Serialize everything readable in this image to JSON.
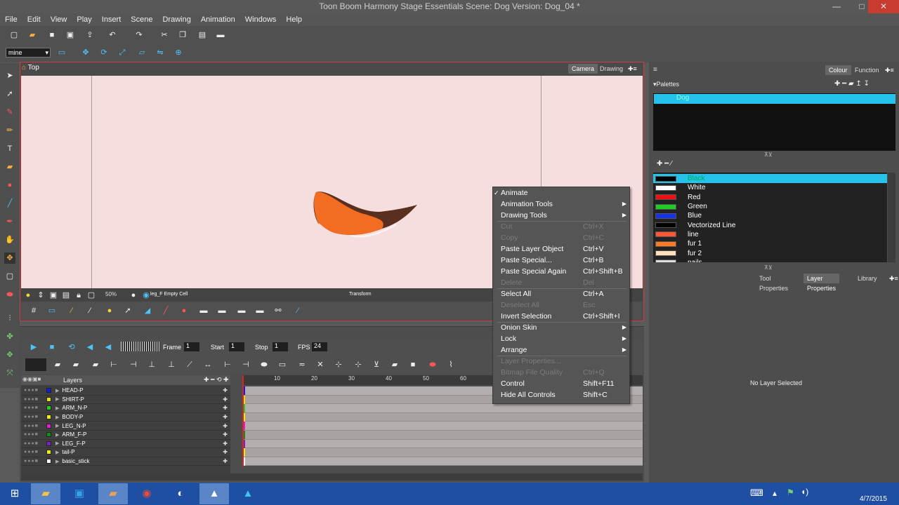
{
  "window": {
    "title": "Toon Boom Harmony Stage Essentials Scene: Dog Version: Dog_04 *",
    "min": "—",
    "max": "□",
    "close": "✕"
  },
  "menus": [
    "File",
    "Edit",
    "View",
    "Play",
    "Insert",
    "Scene",
    "Drawing",
    "Animation",
    "Windows",
    "Help"
  ],
  "toolbar": {
    "preset_value": "mine"
  },
  "view": {
    "tab": "Top",
    "camera_tab": "Camera",
    "drawing_tab": "Drawing",
    "zoom": "50%",
    "layer_name": "leg_F Empty Cell",
    "mode": "Transform"
  },
  "timeline": {
    "frame_label": "Frame",
    "frame_value": "1",
    "start_label": "Start",
    "start_value": "1",
    "stop_label": "Stop",
    "stop_value": "1",
    "fps_label": "FPS",
    "fps_value": "24",
    "layers_header": "Layers",
    "ruler": [
      "10",
      "20",
      "30",
      "40",
      "50",
      "60"
    ]
  },
  "layers": [
    {
      "name": "HEAD-P",
      "color": "#1020e0"
    },
    {
      "name": "SHIRT-P",
      "color": "#e8e000"
    },
    {
      "name": "ARM_N-P",
      "color": "#20d020"
    },
    {
      "name": "BODY-P",
      "color": "#f0f000"
    },
    {
      "name": "LEG_N-P",
      "color": "#e020d0"
    },
    {
      "name": "ARM_F-P",
      "color": "#109010"
    },
    {
      "name": "LEG_F-P",
      "color": "#8020c0"
    },
    {
      "name": "tail-P",
      "color": "#f0f000"
    },
    {
      "name": "basic_stick",
      "color": "#ffffff"
    }
  ],
  "context_menu": [
    {
      "label": "Animate",
      "check": "✓"
    },
    {
      "label": "Animation Tools",
      "submenu": true
    },
    {
      "label": "Drawing Tools",
      "submenu": true
    },
    {
      "sep": true
    },
    {
      "label": "Cut",
      "shortcut": "Ctrl+X",
      "disabled": true
    },
    {
      "label": "Copy",
      "shortcut": "Ctrl+C",
      "disabled": true
    },
    {
      "label": "Paste Layer Object",
      "shortcut": "Ctrl+V"
    },
    {
      "label": "Paste Special...",
      "shortcut": "Ctrl+B"
    },
    {
      "label": "Paste Special Again",
      "shortcut": "Ctrl+Shift+B"
    },
    {
      "label": "Delete",
      "shortcut": "Del",
      "disabled": true
    },
    {
      "sep": true
    },
    {
      "label": "Select All",
      "shortcut": "Ctrl+A"
    },
    {
      "label": "Deselect All",
      "shortcut": "Esc",
      "disabled": true
    },
    {
      "label": "Invert Selection",
      "shortcut": "Ctrl+Shift+I"
    },
    {
      "sep": true
    },
    {
      "label": "Onion Skin",
      "submenu": true
    },
    {
      "label": "Lock",
      "submenu": true
    },
    {
      "label": "Arrange",
      "submenu": true
    },
    {
      "sep": true
    },
    {
      "label": "Layer Properties...",
      "disabled": true
    },
    {
      "label": "Bitmap File Quality",
      "shortcut": "Ctrl+Q",
      "disabled": true
    },
    {
      "label": "Control",
      "shortcut": "Shift+F11"
    },
    {
      "label": "Hide All Controls",
      "shortcut": "Shift+C"
    }
  ],
  "right": {
    "tab_colour": "Colour",
    "tab_function": "Function",
    "palettes_label": "Palettes",
    "palette_name": "Dog",
    "colours": [
      {
        "name": "Black",
        "hex": "#000000",
        "sel": true
      },
      {
        "name": "White",
        "hex": "#ffffff"
      },
      {
        "name": "Red",
        "hex": "#ee1111"
      },
      {
        "name": "Green",
        "hex": "#22cc22"
      },
      {
        "name": "Blue",
        "hex": "#1133ee"
      },
      {
        "name": "Vectorized Line",
        "hex": "#000000"
      },
      {
        "name": "line",
        "hex": "#ff5533"
      },
      {
        "name": "fur 1",
        "hex": "#ff7a22"
      },
      {
        "name": "fur 2",
        "hex": "#ffe0b8"
      },
      {
        "name": "nails",
        "hex": "#dddddd"
      }
    ],
    "tab_tool": "Tool Properties",
    "tab_layer": "Layer Properties",
    "tab_library": "Library",
    "no_layer": "No Layer Selected"
  },
  "taskbar": {
    "date": "4/7/2015"
  }
}
